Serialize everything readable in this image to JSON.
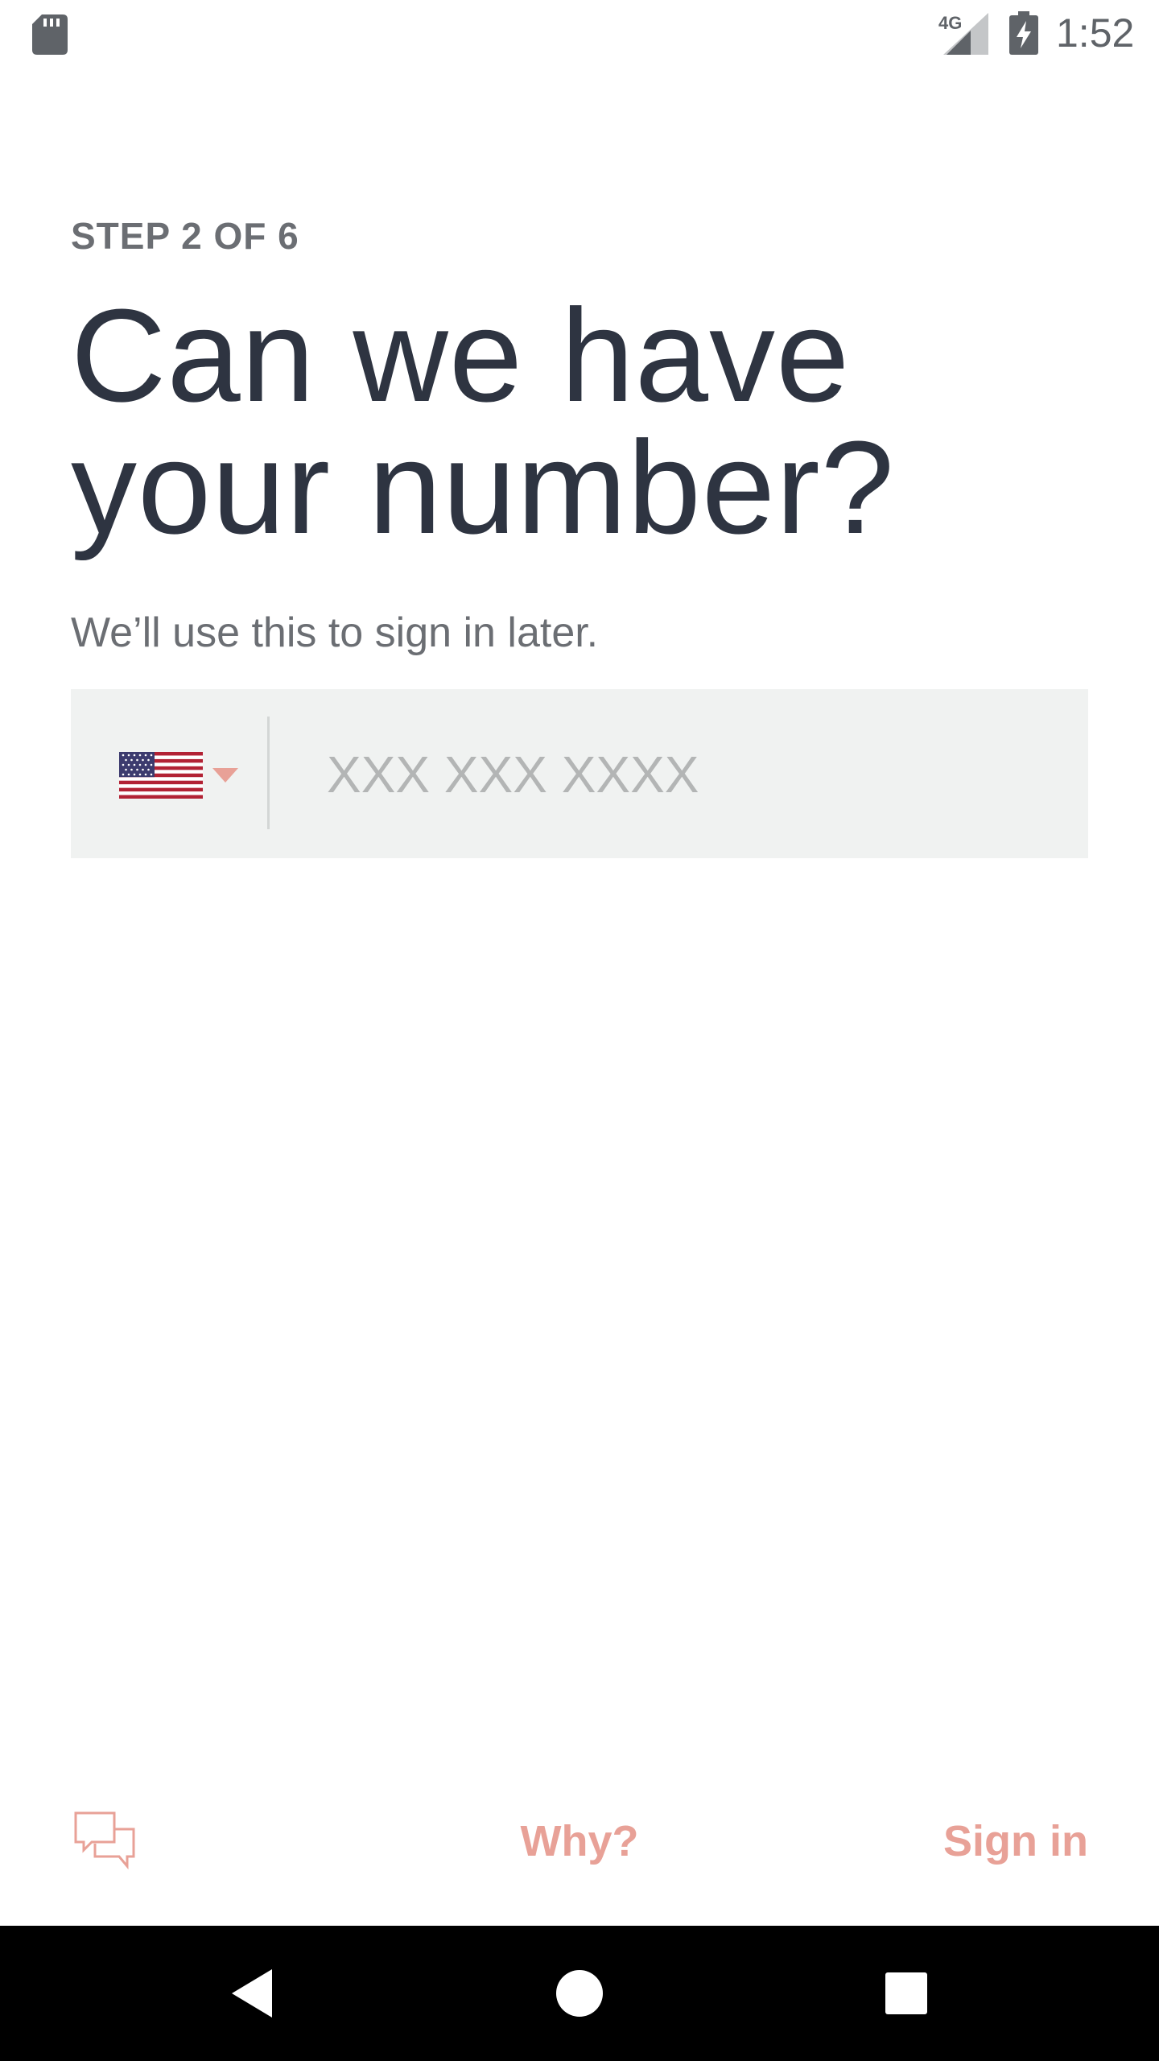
{
  "status_bar": {
    "network": "4G",
    "time": "1:52",
    "icons": [
      "sd-card-icon",
      "signal-icon",
      "battery-charging-icon"
    ]
  },
  "content": {
    "step": "STEP 2 OF 6",
    "title": "Can we have your number?",
    "subtitle": "We’ll use this to sign in later."
  },
  "phone_field": {
    "country_icon": "us-flag-icon",
    "value": "",
    "placeholder": "XXX XXX XXXX"
  },
  "footer": {
    "chat_icon": "chat-bubbles-icon",
    "why_label": "Why?",
    "signin_label": "Sign in"
  },
  "nav_bar": {
    "icons": [
      "back-icon",
      "home-icon",
      "recents-icon"
    ]
  },
  "colors": {
    "accent": "#e8a197",
    "title": "#2e3441",
    "secondary_text": "#6b6e73",
    "field_bg": "#f0f2f1",
    "placeholder": "#b3b5b5",
    "nav_bg": "#000000"
  }
}
